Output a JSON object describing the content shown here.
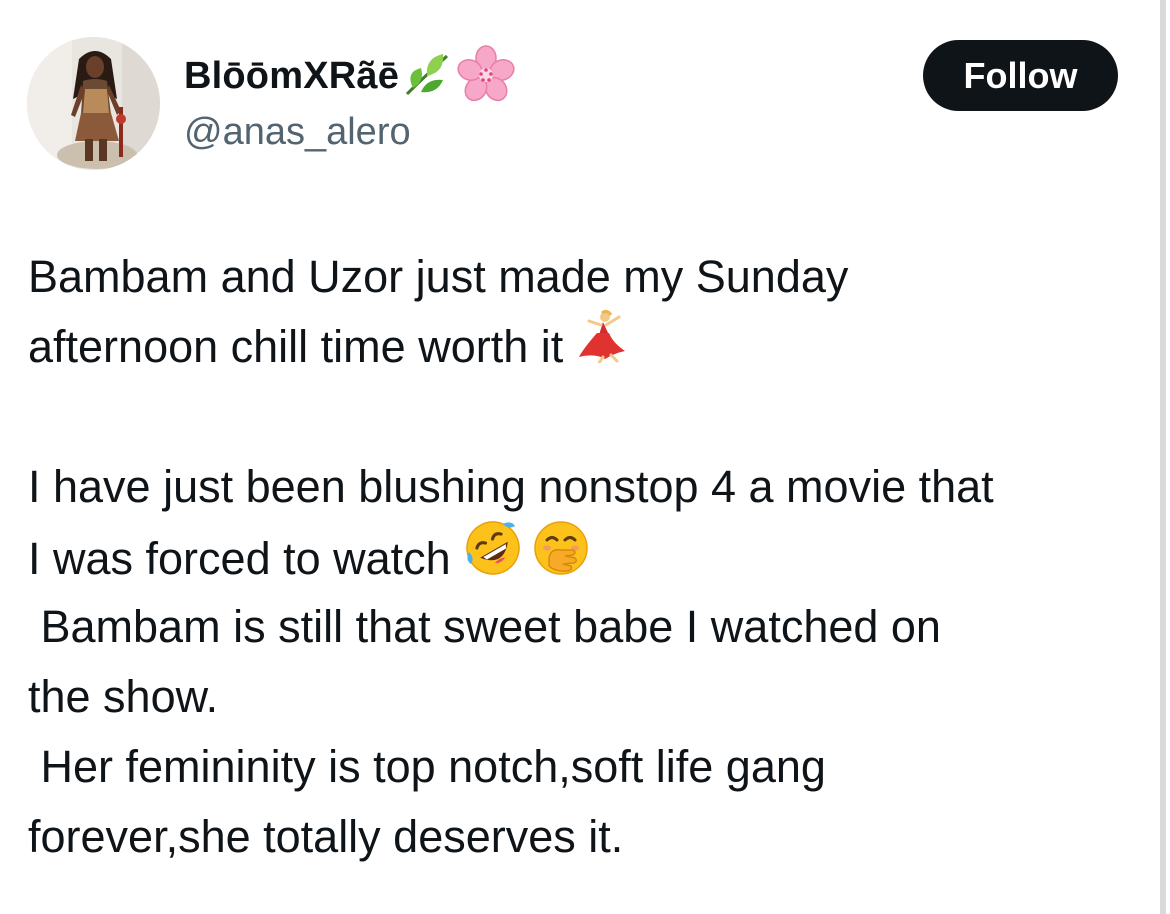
{
  "author": {
    "display_name": "BlōōmXRãē",
    "name_emojis": [
      "herb-icon",
      "cherry-blossom-icon"
    ],
    "handle": "@anas_alero"
  },
  "follow_button": {
    "label": "Follow"
  },
  "tweet": {
    "lines": [
      "Bambam and Uzor just made my Sunday",
      "afternoon chill time worth it",
      "",
      "I have just been blushing nonstop 4 a movie that",
      "I was forced to watch",
      " Bambam is still that sweet babe I watched on",
      "the show.",
      " Her femininity is top notch,soft life gang",
      "forever,she totally deserves it."
    ],
    "inline_emojis": {
      "line_2": [
        "dancing-woman-icon"
      ],
      "line_5": [
        "rolling-laughing-icon",
        "hand-over-mouth-icon"
      ]
    }
  },
  "colors": {
    "text": "#0f1419",
    "secondary_text": "#536471",
    "button_bg": "#0f1419",
    "button_text": "#ffffff",
    "background": "#ffffff"
  }
}
